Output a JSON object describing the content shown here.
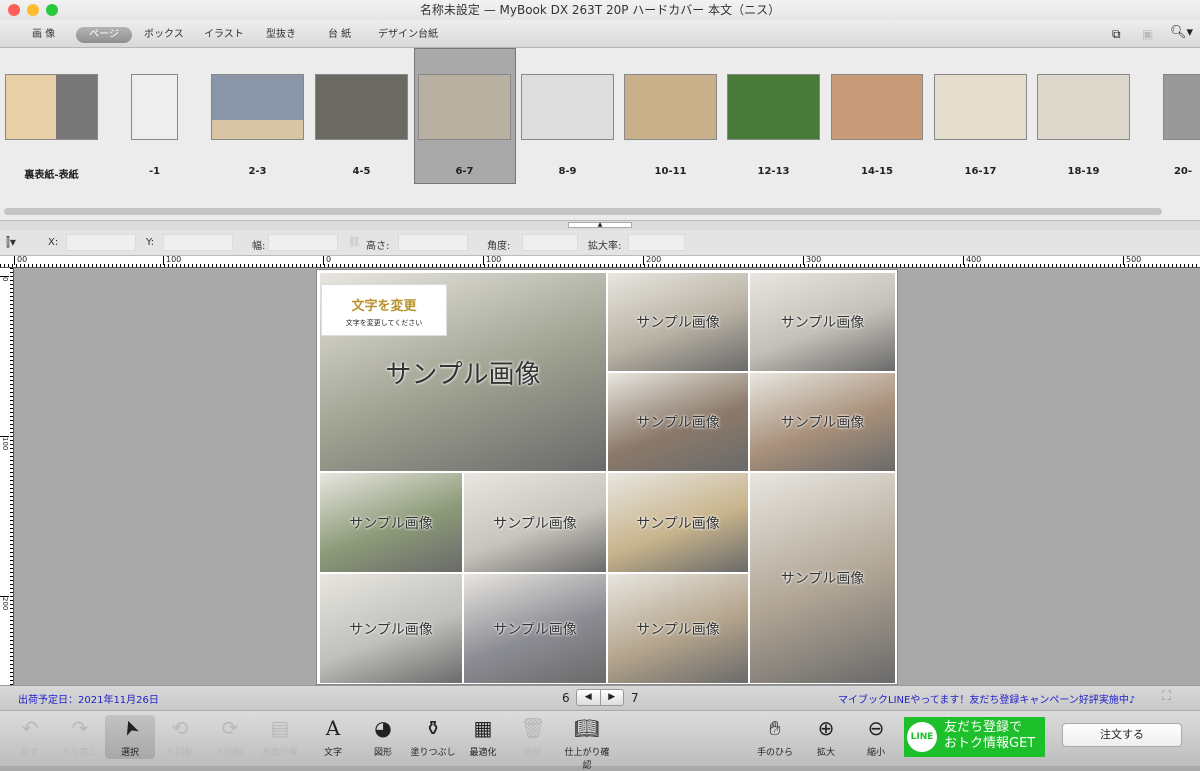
{
  "window": {
    "title": "名称未設定 — MyBook DX 263T 20P ハードカバー 本文（ニス）"
  },
  "tabs": [
    {
      "label": "画 像"
    },
    {
      "label": "ページ",
      "selected": true
    },
    {
      "label": "ボックス"
    },
    {
      "label": "イラスト"
    },
    {
      "label": "型抜き"
    },
    {
      "label": "台 紙"
    },
    {
      "label": "デザイン台紙"
    }
  ],
  "toolbar_right_icons": [
    "copy-icon",
    "paste-icon",
    "search-icon"
  ],
  "thumbnails": [
    {
      "label": "裏表紙-表紙"
    },
    {
      "label": "-1"
    },
    {
      "label": "2-3"
    },
    {
      "label": "4-5"
    },
    {
      "label": "6-7",
      "selected": true
    },
    {
      "label": "8-9"
    },
    {
      "label": "10-11"
    },
    {
      "label": "12-13"
    },
    {
      "label": "14-15"
    },
    {
      "label": "16-17"
    },
    {
      "label": "18-19"
    },
    {
      "label": "20-"
    }
  ],
  "properties": {
    "x_label": "X:",
    "y_label": "Y:",
    "width_label": "幅:",
    "height_label": "高さ:",
    "angle_label": "角度:",
    "scale_label": "拡大率:"
  },
  "ruler": {
    "top": [
      "00",
      "100",
      "0",
      "100",
      "200",
      "300",
      "400",
      "500"
    ],
    "left": [
      "0",
      "100",
      "200"
    ]
  },
  "canvas": {
    "text_title": "文字を変更",
    "text_sub": "文字を変更してください",
    "sample_label": "サンプル画像"
  },
  "status": {
    "ship_date": "出荷予定日：2021年11月26日",
    "page_left": "6",
    "page_right": "7",
    "promo": "マイブックLINEやってます！友だち登録キャンペーン好評実施中♪"
  },
  "tools": [
    {
      "label": "戻す",
      "icon": "undo-icon",
      "enabled": false
    },
    {
      "label": "やり直し",
      "icon": "redo-icon",
      "enabled": false
    },
    {
      "label": "選択",
      "icon": "cursor-icon",
      "enabled": true
    },
    {
      "label": "左回転",
      "icon": "rotate-left-icon",
      "enabled": false
    },
    {
      "label": "右回転",
      "icon": "rotate-right-icon",
      "enabled": false
    },
    {
      "label": "画像効果",
      "icon": "image-effect-icon",
      "enabled": false
    },
    {
      "label": "文字",
      "icon": "text-icon",
      "enabled": true
    },
    {
      "label": "図形",
      "icon": "shape-icon",
      "enabled": true
    },
    {
      "label": "塗りつぶし",
      "icon": "fill-icon",
      "enabled": true
    },
    {
      "label": "最適化",
      "icon": "optimize-icon",
      "enabled": true
    },
    {
      "label": "削除",
      "icon": "trash-icon",
      "enabled": false
    },
    {
      "label": "仕上がり確認",
      "icon": "preview-book-icon",
      "enabled": true
    }
  ],
  "right_tools": [
    {
      "label": "手のひら",
      "icon": "hand-icon"
    },
    {
      "label": "拡大",
      "icon": "zoom-in-icon"
    },
    {
      "label": "縮小",
      "icon": "zoom-out-icon"
    }
  ],
  "line_banner": {
    "logo": "LINE",
    "line1": "友だち登録で",
    "line2": "おトク情報GET"
  },
  "order_button": "注文する",
  "colors": {
    "line_green": "#1dbf2a",
    "promo_blue": "#2222cc",
    "text_gold": "#b8922e"
  }
}
